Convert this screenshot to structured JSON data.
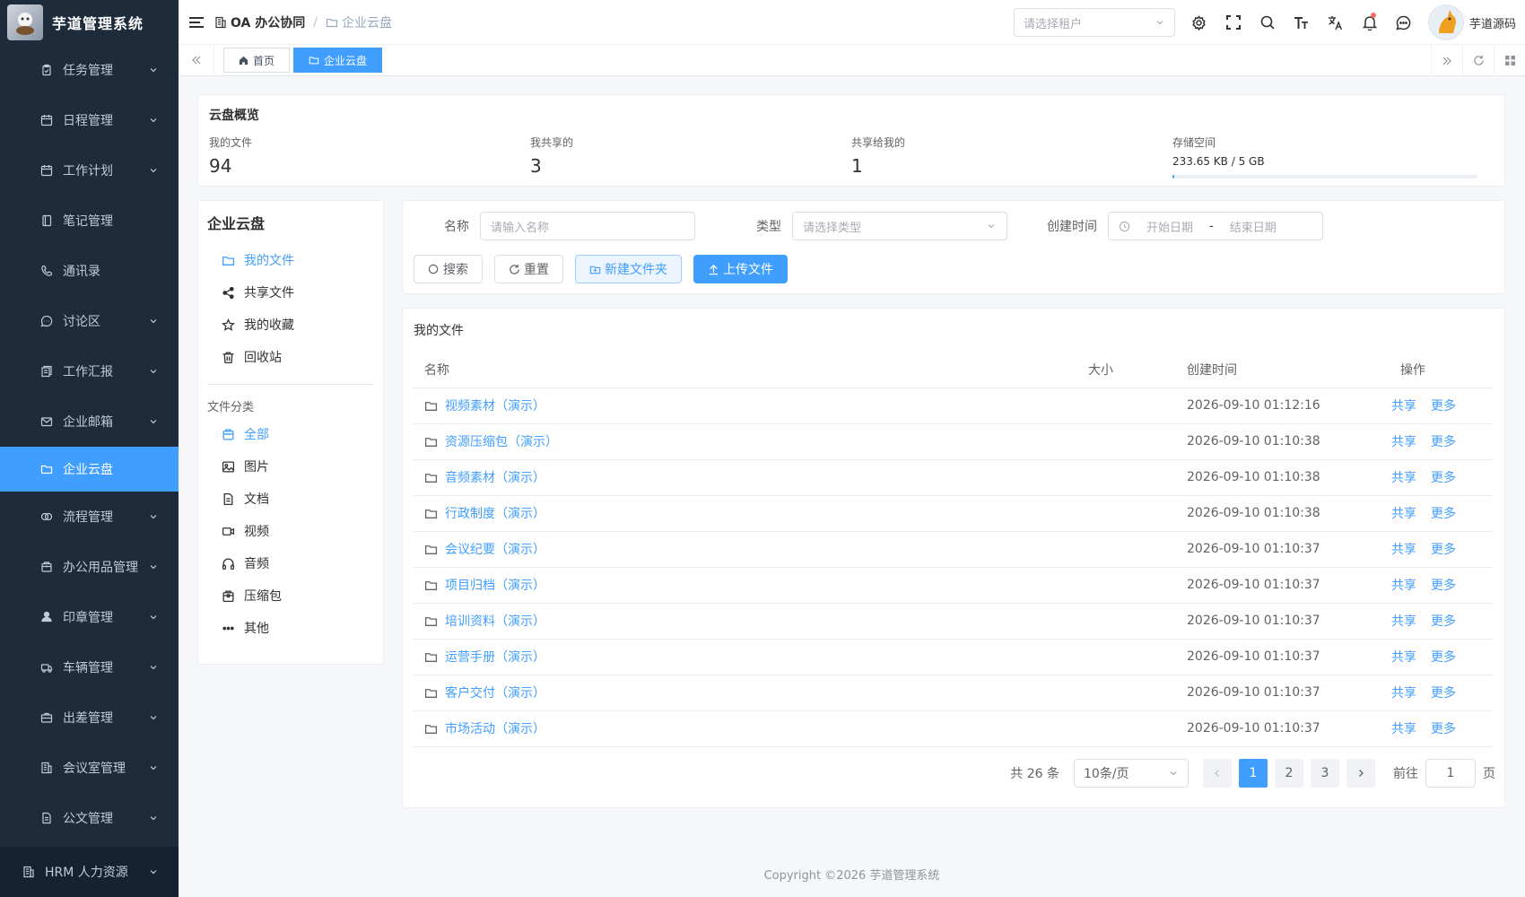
{
  "brand": {
    "title": "芋道管理系统"
  },
  "sidebar": {
    "items": [
      {
        "label": "任务管理",
        "icon": "clipboard-icon",
        "chevron": true
      },
      {
        "label": "日程管理",
        "icon": "calendar-icon",
        "chevron": true
      },
      {
        "label": "工作计划",
        "icon": "calendar-icon",
        "chevron": true
      },
      {
        "label": "笔记管理",
        "icon": "notebook-icon",
        "chevron": false
      },
      {
        "label": "通讯录",
        "icon": "phone-icon",
        "chevron": false
      },
      {
        "label": "讨论区",
        "icon": "chat-icon",
        "chevron": true
      },
      {
        "label": "工作汇报",
        "icon": "report-icon",
        "chevron": true
      },
      {
        "label": "企业邮箱",
        "icon": "mail-icon",
        "chevron": true
      },
      {
        "label": "企业云盘",
        "icon": "folder-icon",
        "chevron": false,
        "active": true
      },
      {
        "label": "流程管理",
        "icon": "flow-icon",
        "chevron": true
      },
      {
        "label": "办公用品管理",
        "icon": "box-icon",
        "chevron": true
      },
      {
        "label": "印章管理",
        "icon": "stamp-icon",
        "chevron": true
      },
      {
        "label": "车辆管理",
        "icon": "car-icon",
        "chevron": true
      },
      {
        "label": "出差管理",
        "icon": "briefcase-icon",
        "chevron": true
      },
      {
        "label": "会议室管理",
        "icon": "building-icon",
        "chevron": true
      },
      {
        "label": "公文管理",
        "icon": "document-icon",
        "chevron": true
      }
    ],
    "bottom": {
      "label": "HRM 人力资源",
      "icon": "building-icon"
    }
  },
  "header": {
    "breadcrumb": [
      "OA 办公协同",
      "企业云盘"
    ],
    "tenant_placeholder": "请选择租户",
    "user_name": "芋道源码"
  },
  "tabs": [
    {
      "label": "首页",
      "icon": "home-icon",
      "active": false
    },
    {
      "label": "企业云盘",
      "icon": "folder-icon",
      "active": true
    }
  ],
  "overview": {
    "title": "云盘概览",
    "stats": [
      {
        "label": "我的文件",
        "value": "94"
      },
      {
        "label": "我共享的",
        "value": "3"
      },
      {
        "label": "共享给我的",
        "value": "1"
      }
    ],
    "storage": {
      "label": "存储空间",
      "value": "233.65 KB / 5 GB",
      "percent": 0.5
    }
  },
  "leftnav": {
    "title": "企业云盘",
    "items": [
      {
        "label": "我的文件",
        "icon": "folder-icon",
        "active": true
      },
      {
        "label": "共享文件",
        "icon": "share-icon",
        "active": false
      },
      {
        "label": "我的收藏",
        "icon": "star-icon",
        "active": false
      },
      {
        "label": "回收站",
        "icon": "trash-icon",
        "active": false
      }
    ],
    "section": "文件分类",
    "categories": [
      {
        "label": "全部",
        "icon": "box-icon",
        "active": true
      },
      {
        "label": "图片",
        "icon": "image-icon",
        "active": false
      },
      {
        "label": "文档",
        "icon": "document-icon",
        "active": false
      },
      {
        "label": "视频",
        "icon": "video-icon",
        "active": false
      },
      {
        "label": "音频",
        "icon": "headphones-icon",
        "active": false
      },
      {
        "label": "压缩包",
        "icon": "archive-icon",
        "active": false
      },
      {
        "label": "其他",
        "icon": "more-icon",
        "active": false
      }
    ]
  },
  "search": {
    "name_label": "名称",
    "name_placeholder": "请输入名称",
    "type_label": "类型",
    "type_placeholder": "请选择类型",
    "time_label": "创建时间",
    "start_placeholder": "开始日期",
    "range_sep": "-",
    "end_placeholder": "结束日期",
    "search_btn": "搜索",
    "reset_btn": "重置",
    "new_folder_btn": "新建文件夹",
    "upload_btn": "上传文件"
  },
  "table": {
    "title": "我的文件",
    "headers": [
      "名称",
      "大小",
      "创建时间",
      "操作"
    ],
    "op_share": "共享",
    "op_more": "更多",
    "rows": [
      {
        "name": "视频素材（演示）",
        "size": "",
        "time": "2026-09-10 01:12:16"
      },
      {
        "name": "资源压缩包（演示）",
        "size": "",
        "time": "2026-09-10 01:10:38"
      },
      {
        "name": "音频素材（演示）",
        "size": "",
        "time": "2026-09-10 01:10:38"
      },
      {
        "name": "行政制度（演示）",
        "size": "",
        "time": "2026-09-10 01:10:38"
      },
      {
        "name": "会议纪要（演示）",
        "size": "",
        "time": "2026-09-10 01:10:37"
      },
      {
        "name": "项目归档（演示）",
        "size": "",
        "time": "2026-09-10 01:10:37"
      },
      {
        "name": "培训资料（演示）",
        "size": "",
        "time": "2026-09-10 01:10:37"
      },
      {
        "name": "运营手册（演示）",
        "size": "",
        "time": "2026-09-10 01:10:37"
      },
      {
        "name": "客户交付（演示）",
        "size": "",
        "time": "2026-09-10 01:10:37"
      },
      {
        "name": "市场活动（演示）",
        "size": "",
        "time": "2026-09-10 01:10:37"
      }
    ]
  },
  "pagination": {
    "total": "共 26 条",
    "page_size": "10条/页",
    "pages": [
      "1",
      "2",
      "3"
    ],
    "current": "1",
    "goto_label": "前往",
    "goto_value": "1",
    "page_suffix": "页"
  },
  "footer": {
    "copyright": "Copyright ©2026 芋道管理系统"
  },
  "colors": {
    "accent": "#409eff",
    "sidebar_bg": "#1d2b3a"
  }
}
